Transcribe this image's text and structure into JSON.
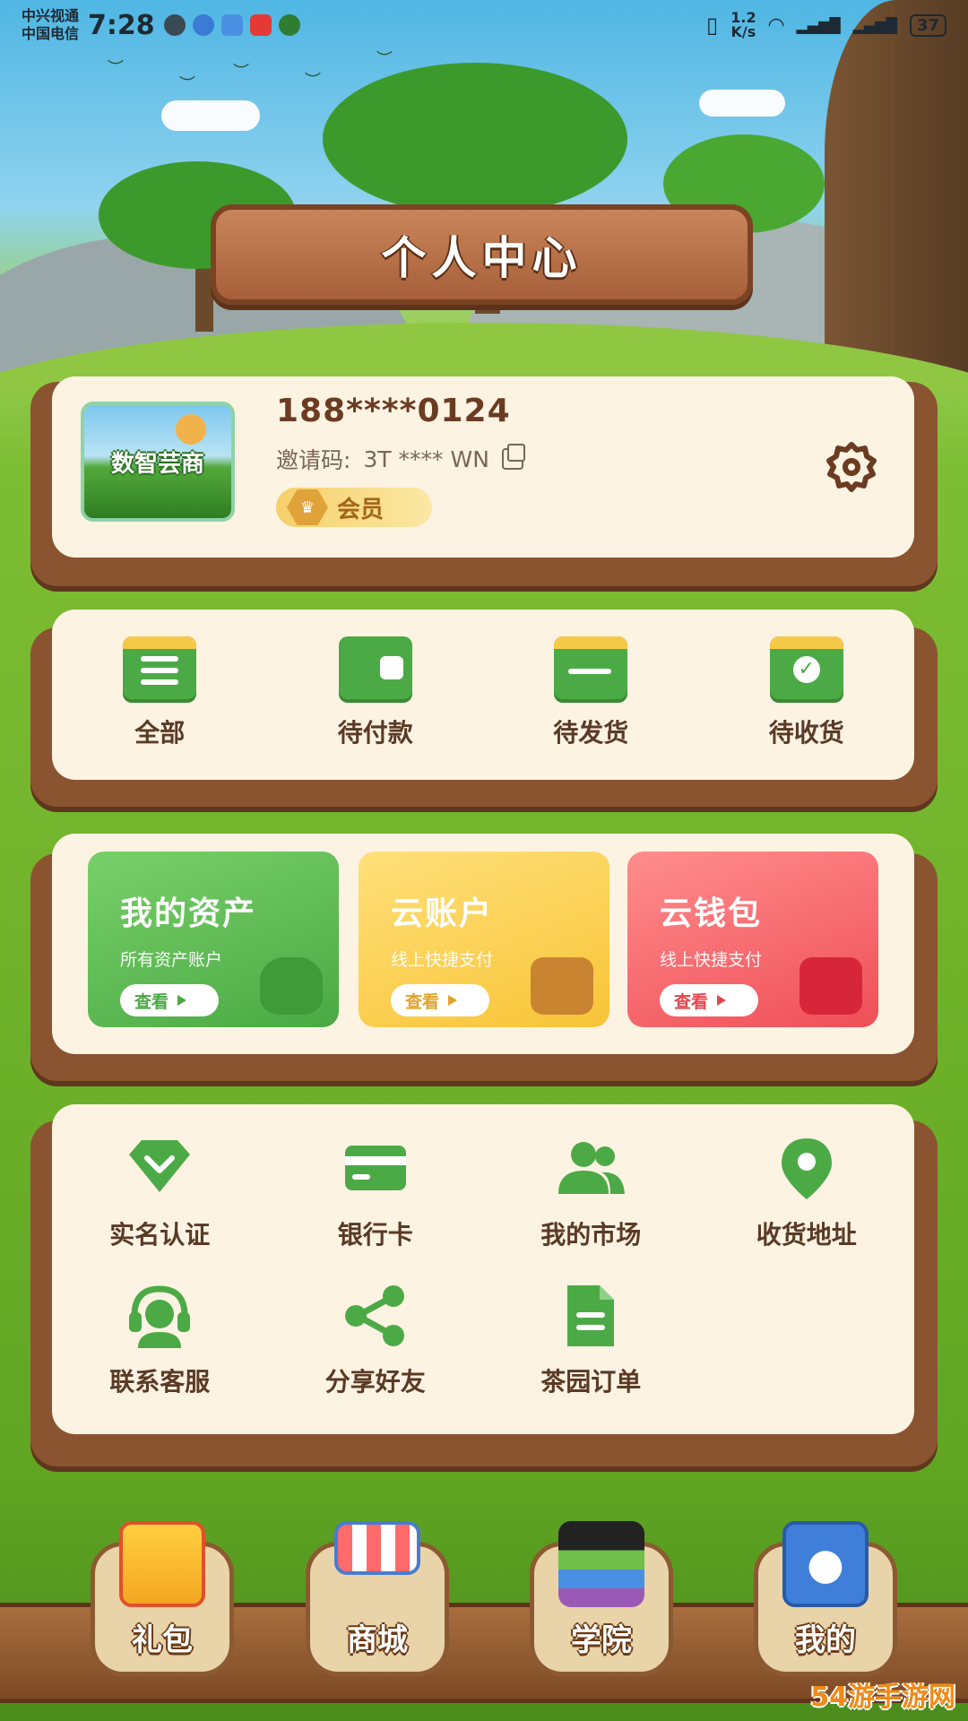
{
  "status_bar": {
    "carrier_1": "中兴视通",
    "carrier_2": "中国电信",
    "time": "7:28",
    "net_speed_value": "1.2",
    "net_speed_unit": "K/s",
    "battery": "37"
  },
  "header": {
    "title": "个人中心"
  },
  "profile": {
    "avatar_text": "数智芸商",
    "phone": "188****0124",
    "invite_label": "邀请码:",
    "invite_code": "3T **** WN",
    "member_label": "会员"
  },
  "orders": [
    {
      "label": "全部",
      "icon": "clipboard-icon"
    },
    {
      "label": "待付款",
      "icon": "wallet-icon"
    },
    {
      "label": "待发货",
      "icon": "shipping-box-icon"
    },
    {
      "label": "待收货",
      "icon": "receive-box-icon"
    }
  ],
  "assets": [
    {
      "title": "我的资产",
      "subtitle": "所有资产账户",
      "button": "查看",
      "color": "#4aa944"
    },
    {
      "title": "云账户",
      "subtitle": "线上快捷支付",
      "button": "查看",
      "color": "#f8c437"
    },
    {
      "title": "云钱包",
      "subtitle": "线上快捷支付",
      "button": "查看",
      "color": "#ef4f57"
    }
  ],
  "services": [
    {
      "label": "实名认证",
      "icon": "verified-shield-icon"
    },
    {
      "label": "银行卡",
      "icon": "bank-card-icon"
    },
    {
      "label": "我的市场",
      "icon": "people-icon"
    },
    {
      "label": "收货地址",
      "icon": "location-pin-icon"
    },
    {
      "label": "联系客服",
      "icon": "headset-icon"
    },
    {
      "label": "分享好友",
      "icon": "share-icon"
    },
    {
      "label": "茶园订单",
      "icon": "document-icon"
    }
  ],
  "bottom_nav": [
    {
      "label": "礼包",
      "icon": "gift-icon"
    },
    {
      "label": "商城",
      "icon": "shop-icon"
    },
    {
      "label": "学院",
      "icon": "graduation-cap-icon"
    },
    {
      "label": "我的",
      "icon": "user-profile-icon"
    }
  ],
  "watermark": "54游手游网",
  "colors": {
    "accent_green": "#4caa46",
    "wood": "#8a5430",
    "card_bg": "#fdf3e3"
  }
}
